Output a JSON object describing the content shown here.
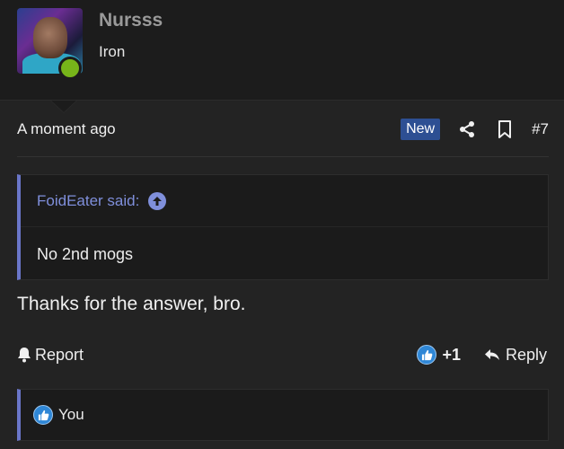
{
  "user": {
    "name": "Nursss",
    "title": "Iron",
    "online": true,
    "online_color": "#77b51a"
  },
  "meta": {
    "time": "A moment ago",
    "badge": "New",
    "share_icon": "share-icon",
    "bookmark_icon": "bookmark-icon",
    "post_number": "#7"
  },
  "quote": {
    "author_said": "FoidEater said:",
    "body": "No 2nd mogs"
  },
  "message": {
    "text": "Thanks for the answer, bro."
  },
  "actions": {
    "report_label": "Report",
    "like_count": "+1",
    "reply_label": "Reply"
  },
  "reactions": {
    "text": "You"
  },
  "colors": {
    "accent": "#6a76c9",
    "badge": "#2d4f93",
    "like": "#2f87d6",
    "background": "#232323"
  }
}
